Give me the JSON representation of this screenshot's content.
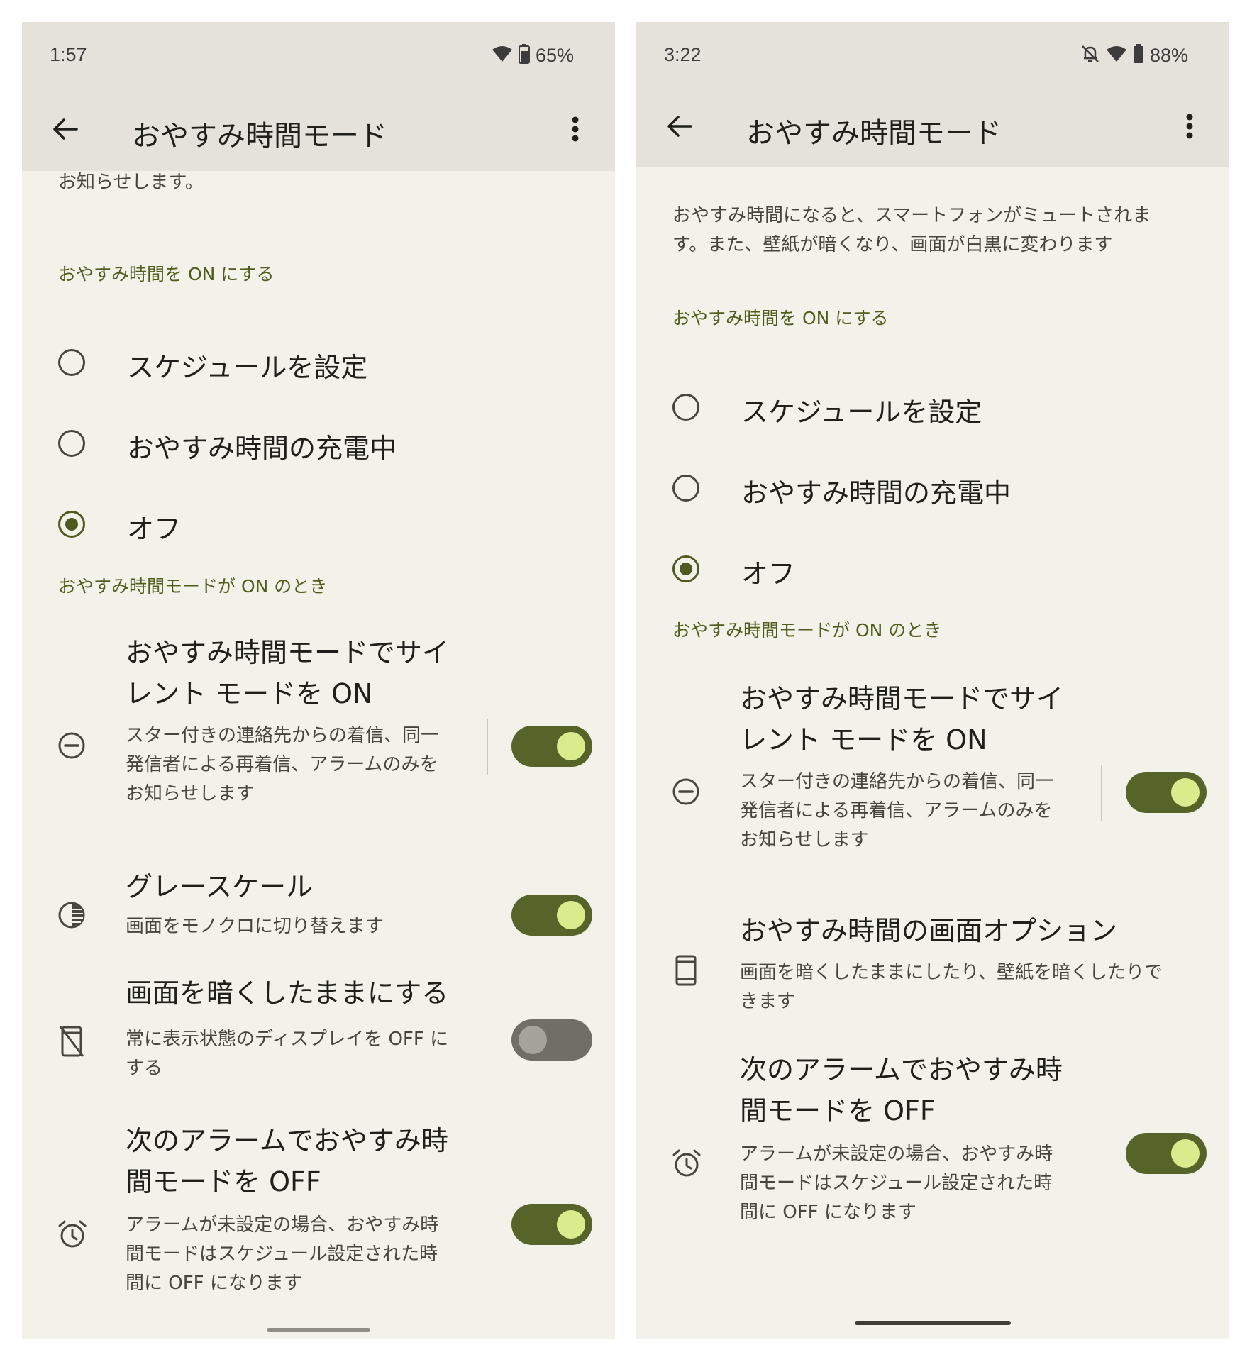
{
  "left": {
    "status": {
      "time": "1:57",
      "battery": "65%"
    },
    "appbar": {
      "title": "おやすみ時間モード"
    },
    "intro_fragment": "お知らせします。",
    "section_schedule": "おやすみ時間を ON にする",
    "radios": [
      {
        "label": "スケジュールを設定",
        "selected": false
      },
      {
        "label": "おやすみ時間の充電中",
        "selected": false
      },
      {
        "label": "オフ",
        "selected": true
      }
    ],
    "section_when_on": "おやすみ時間モードが ON のとき",
    "dnd": {
      "title_line1": "おやすみ時間モードでサイ",
      "title_line2": "レント モードを ON",
      "sub_line1": "スター付きの連絡先からの着信、同一",
      "sub_line2": "発信者による再着信、アラームのみを",
      "sub_line3": "お知らせします",
      "on": true
    },
    "grayscale": {
      "title": "グレースケール",
      "sub": "画面をモノクロに切り替えます",
      "on": true
    },
    "keep_dark": {
      "title": "画面を暗くしたままにする",
      "sub_line1": "常に表示状態のディスプレイを OFF に",
      "sub_line2": "する",
      "on": false
    },
    "alarm_off": {
      "title_line1": "次のアラームでおやすみ時",
      "title_line2": "間モードを OFF",
      "sub_line1": "アラームが未設定の場合、おやすみ時",
      "sub_line2": "間モードはスケジュール設定された時",
      "sub_line3": "間に OFF になります",
      "on": true
    }
  },
  "right": {
    "status": {
      "time": "3:22",
      "battery": "88%"
    },
    "appbar": {
      "title": "おやすみ時間モード"
    },
    "intro_line1": "おやすみ時間になると、スマートフォンがミュートされま",
    "intro_line2": "す。また、壁紙が暗くなり、画面が白黒に変わります",
    "section_schedule": "おやすみ時間を ON にする",
    "radios": [
      {
        "label": "スケジュールを設定",
        "selected": false
      },
      {
        "label": "おやすみ時間の充電中",
        "selected": false
      },
      {
        "label": "オフ",
        "selected": true
      }
    ],
    "section_when_on": "おやすみ時間モードが ON のとき",
    "dnd": {
      "title_line1": "おやすみ時間モードでサイ",
      "title_line2": "レント モードを ON",
      "sub_line1": "スター付きの連絡先からの着信、同一",
      "sub_line2": "発信者による再着信、アラームのみを",
      "sub_line3": "お知らせします",
      "on": true
    },
    "screen_options": {
      "title": "おやすみ時間の画面オプション",
      "sub_line1": "画面を暗くしたままにしたり、壁紙を暗くしたりで",
      "sub_line2": "きます"
    },
    "alarm_off": {
      "title_line1": "次のアラームでおやすみ時",
      "title_line2": "間モードを OFF",
      "sub_line1": "アラームが未設定の場合、おやすみ時",
      "sub_line2": "間モードはスケジュール設定された時",
      "sub_line3": "間に OFF になります",
      "on": true
    }
  },
  "colors": {
    "background": "#f2f1ea",
    "appbar": "#e4e2db",
    "accent": "#56642a",
    "knob_on": "#d8ec8e",
    "section_header": "#4e5e1a"
  },
  "icons": {
    "back": "arrow-back-icon",
    "menu": "more-vert-icon",
    "wifi": "wifi-icon",
    "battery": "battery-icon",
    "mute": "notifications-off-icon",
    "dnd": "do-not-disturb-icon",
    "grayscale": "contrast-icon",
    "dark_screen": "screen-off-icon",
    "screen_options": "phone-screen-icon",
    "alarm": "alarm-icon"
  }
}
